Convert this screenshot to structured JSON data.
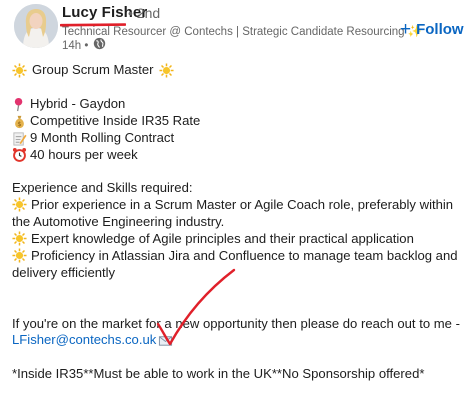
{
  "author": {
    "name": "Lucy Fisher",
    "degree": "• 2nd",
    "headline": "Technical Resourcer @ Contechs | Strategic Candidate Resourcing ✨",
    "time": "14h •",
    "visibility_icon": "globe-icon"
  },
  "follow": {
    "label": "Follow",
    "icon": "plus-icon"
  },
  "post": {
    "title": "Group Scrum Master",
    "details": [
      {
        "icon": "pin-icon",
        "text": "Hybrid - Gaydon"
      },
      {
        "icon": "money-bag-icon",
        "text": "Competitive Inside IR35 Rate"
      },
      {
        "icon": "memo-icon",
        "text": "9 Month Rolling Contract"
      },
      {
        "icon": "alarm-clock-icon",
        "text": " 40 hours per week"
      }
    ],
    "experience_heading": "Experience and Skills required:",
    "skills": [
      "Prior experience in a Scrum Master or Agile Coach role, preferably within the Automotive Engineering industry.",
      "Expert knowledge of Agile principles and their practical application",
      "Proficiency in Atlassian Jira and Confluence to manage team backlog and delivery efficiently"
    ],
    "cta": "If you're on the market for a new opportunity then please do reach out to me -",
    "email": "LFisher@contechs.co.uk",
    "footer": "*Inside IR35**Must be able to work in the UK**No Sponsorship offered*"
  },
  "colors": {
    "link": "#0a66c2",
    "text": "#1d1d1d",
    "muted": "#666666",
    "annotation_red": "#e0202a"
  }
}
